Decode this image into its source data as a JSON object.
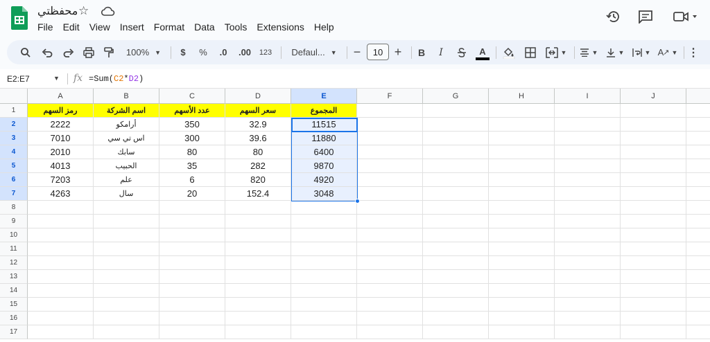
{
  "document": {
    "title": "محفظتي"
  },
  "menu": [
    "File",
    "Edit",
    "View",
    "Insert",
    "Format",
    "Data",
    "Tools",
    "Extensions",
    "Help"
  ],
  "toolbar": {
    "zoom": "100%",
    "currency": "$",
    "percent": "%",
    "decrease_decimal": ".0",
    "increase_decimal": ".00",
    "number_format": "123",
    "font": "Defaul...",
    "font_size": "10",
    "bold": "B",
    "italic": "I",
    "text_color_letter": "A",
    "text_rotation_letter": "A"
  },
  "formula_bar": {
    "name_box": "E2:E7",
    "fx": "fx",
    "formula_prefix": "=Sum(",
    "ref1": "C2",
    "op": "*",
    "ref2": "D2",
    "formula_suffix": ")"
  },
  "columns": [
    "A",
    "B",
    "C",
    "D",
    "E",
    "F",
    "G",
    "H",
    "I",
    "J"
  ],
  "row_numbers": [
    "1",
    "2",
    "3",
    "4",
    "5",
    "6",
    "7",
    "8",
    "9",
    "10",
    "11",
    "12",
    "13",
    "14",
    "15",
    "16",
    "17"
  ],
  "sheet": {
    "headers": [
      "رمز السهم",
      "اسم الشركة",
      "عدد الأسهم",
      "سعر السهم",
      "المجموع"
    ],
    "rows": [
      [
        "2222",
        "أرامكو",
        "350",
        "32.9",
        "11515"
      ],
      [
        "7010",
        "اس تي سي",
        "300",
        "39.6",
        "11880"
      ],
      [
        "2010",
        "سابك",
        "80",
        "80",
        "6400"
      ],
      [
        "4013",
        "الحبيب",
        "35",
        "282",
        "9870"
      ],
      [
        "7203",
        "علم",
        "6",
        "820",
        "4920"
      ],
      [
        "4263",
        "سال",
        "20",
        "152.4",
        "3048"
      ]
    ]
  },
  "colors": {
    "header_fill": "#ffff00",
    "selection": "#1a73e8",
    "selection_fill": "#e8f0fe",
    "selected_header": "#d3e3fd"
  }
}
